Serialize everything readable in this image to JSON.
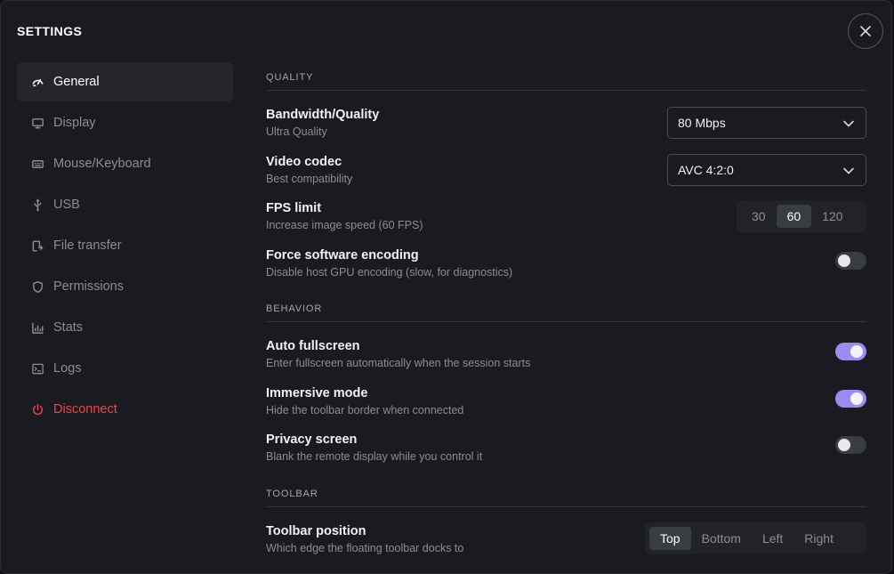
{
  "window": {
    "title": "SETTINGS"
  },
  "sidebar": {
    "items": [
      {
        "label": "General",
        "icon": "gauge-icon",
        "active": true
      },
      {
        "label": "Display",
        "icon": "monitor-icon"
      },
      {
        "label": "Mouse/Keyboard",
        "icon": "keyboard-icon"
      },
      {
        "label": "USB",
        "icon": "usb-icon"
      },
      {
        "label": "File transfer",
        "icon": "file-transfer-icon"
      },
      {
        "label": "Permissions",
        "icon": "shield-icon"
      },
      {
        "label": "Stats",
        "icon": "bar-chart-icon"
      },
      {
        "label": "Logs",
        "icon": "terminal-icon"
      },
      {
        "label": "Disconnect",
        "icon": "power-icon",
        "color": "#e5484d"
      }
    ]
  },
  "sections": {
    "quality": {
      "heading": "QUALITY",
      "bandwidth": {
        "title": "Bandwidth/Quality",
        "subtitle": "Ultra Quality",
        "value": "80 Mbps"
      },
      "codec": {
        "title": "Video codec",
        "subtitle": "Best compatibility",
        "value": "AVC 4:2:0"
      },
      "fps": {
        "title": "FPS limit",
        "subtitle": "Increase image speed (60 FPS)",
        "options": [
          "30",
          "60",
          "120"
        ],
        "selected": "60"
      },
      "software_encoding": {
        "title": "Force software encoding",
        "subtitle": "Disable host GPU encoding (slow, for diagnostics)",
        "on": false
      }
    },
    "behavior": {
      "heading": "BEHAVIOR",
      "auto_fullscreen": {
        "title": "Auto fullscreen",
        "subtitle": "Enter fullscreen automatically when the session starts",
        "on": true
      },
      "immersive": {
        "title": "Immersive mode",
        "subtitle": "Hide the toolbar border when connected",
        "on": true
      },
      "privacy": {
        "title": "Privacy screen",
        "subtitle": "Blank the remote display while you control it",
        "on": false
      }
    },
    "toolbar": {
      "heading": "TOOLBAR",
      "position": {
        "title": "Toolbar position",
        "subtitle": "Which edge the floating toolbar docks to",
        "options": [
          "Top",
          "Bottom",
          "Left",
          "Right"
        ],
        "selected": "Top"
      }
    }
  },
  "colors": {
    "accent": "#9b8cf2",
    "danger": "#e5484d",
    "background": "#1a1b20"
  }
}
